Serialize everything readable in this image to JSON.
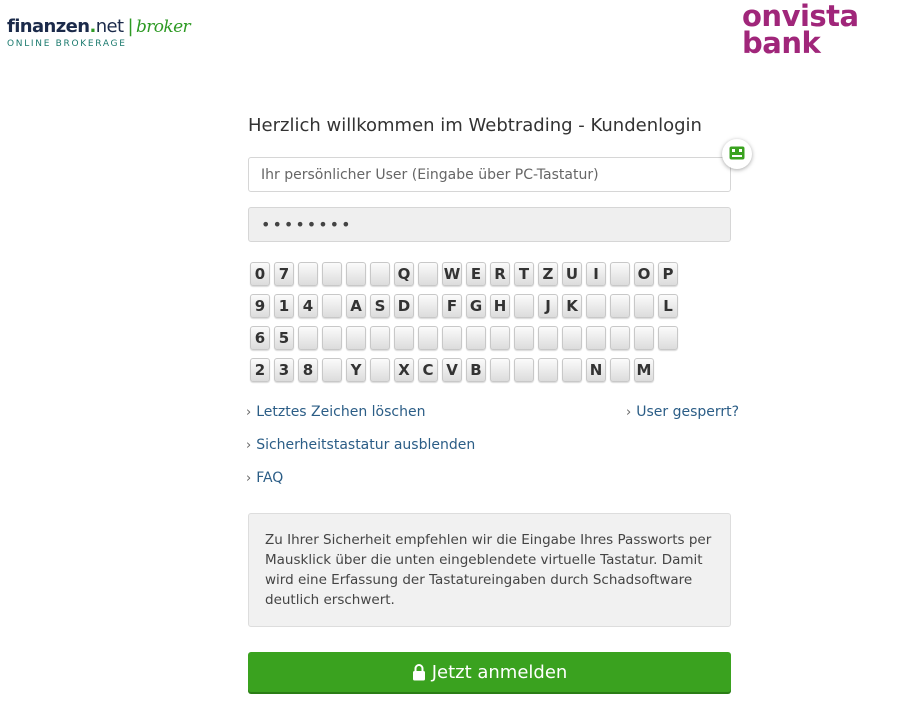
{
  "header": {
    "left_logo": {
      "part1": "finanzen",
      "dot": ".",
      "part2": "net",
      "separator": "|",
      "part3": "broker",
      "subtitle": "ONLINE BROKERAGE"
    },
    "right_logo": {
      "line1": "onvista",
      "line2": "bank"
    }
  },
  "login": {
    "title": "Herzlich willkommen im Webtrading - Kundenlogin",
    "user_placeholder": "Ihr persönlicher User (Eingabe über PC-Tastatur)",
    "user_value": "",
    "password_value": "••••••••",
    "keyboard_toggle_icon": "keyboard-icon"
  },
  "keyboard": {
    "rows": [
      [
        "0",
        "7",
        "",
        "",
        "",
        "",
        "Q",
        "",
        "W",
        "E",
        "R",
        "T",
        "Z",
        "U",
        "I",
        "",
        "O",
        "P"
      ],
      [
        "9",
        "1",
        "4",
        "",
        "A",
        "S",
        "D",
        "",
        "F",
        "G",
        "H",
        "",
        "J",
        "K",
        "",
        "",
        "",
        "L"
      ],
      [
        "6",
        "5",
        "",
        "",
        "",
        "",
        "",
        "",
        "",
        "",
        "",
        "",
        "",
        "",
        "",
        "",
        "",
        ""
      ],
      [
        "2",
        "3",
        "8",
        "",
        "Y",
        "",
        "X",
        "C",
        "V",
        "B",
        "",
        "",
        "",
        "",
        "N",
        "",
        "M"
      ]
    ]
  },
  "links": {
    "delete_last": "Letztes Zeichen löschen",
    "user_locked": "User gesperrt?",
    "hide_keyboard": "Sicherheitstastatur ausblenden",
    "faq": "FAQ"
  },
  "info_text": "Zu Ihrer Sicherheit empfehlen wir die Eingabe Ihres Passworts per Mausklick über die unten eingeblendete virtuelle Tastatur. Damit wird eine Erfassung der Tastatureingaben durch Schadsoftware deutlich erschwert.",
  "submit": {
    "label": "Jetzt anmelden",
    "icon": "lock-icon"
  },
  "colors": {
    "accent_green": "#3aa21f",
    "brand_purple": "#a0267a",
    "link_blue": "#2b5d86"
  }
}
